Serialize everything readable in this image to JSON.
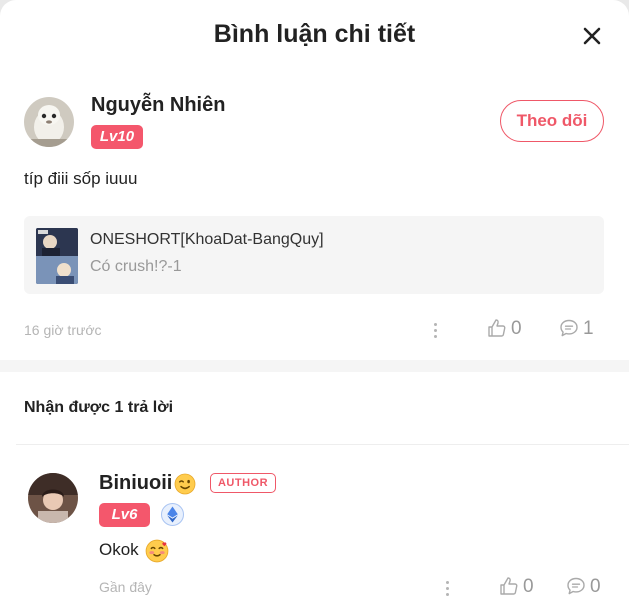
{
  "header": {
    "title": "Bình luận chi tiết"
  },
  "comment": {
    "user_name": "Nguyễn Nhiên",
    "level": "Lv10",
    "follow_label": "Theo dõi",
    "text": "típ điii sốp iuuu",
    "work": {
      "title": "ONESHORT[KhoaDat-BangQuy]",
      "subtitle": "Có crush!?-1"
    },
    "time": "16 giờ trước",
    "likes": "0",
    "replies": "1"
  },
  "replies_section": {
    "title": "Nhận được 1 trả lời"
  },
  "reply": {
    "user_name": "Biniuoii",
    "author_tag": "AUTHOR",
    "level": "Lv6",
    "text": "Okok",
    "time": "Gần đây",
    "likes": "0",
    "replies": "0"
  },
  "colors": {
    "accent": "#ef5868",
    "level_badge": "#f4576c",
    "muted": "#b5b5b5",
    "card_bg": "#f5f5f5"
  },
  "icons": [
    "close-icon",
    "more-icon",
    "thumbs-up-icon",
    "chat-bubble-icon",
    "wink-emoji-icon",
    "blush-emoji-icon",
    "diamond-badge-icon"
  ]
}
